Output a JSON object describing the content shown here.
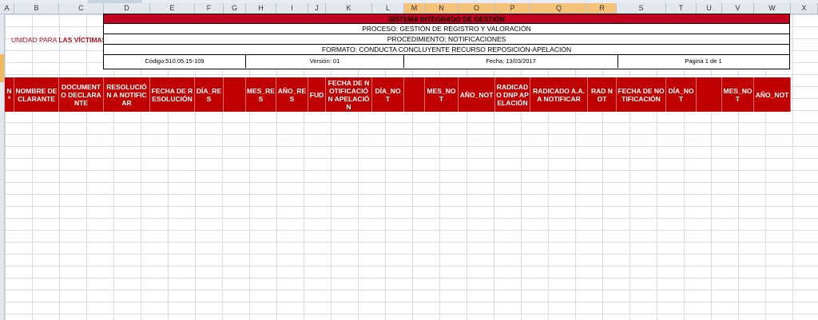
{
  "columns": [
    "A",
    "B",
    "C",
    "D",
    "E",
    "F",
    "G",
    "H",
    "I",
    "J",
    "K",
    "L",
    "M",
    "N",
    "O",
    "P",
    "Q",
    "R",
    "S",
    "T",
    "U",
    "V",
    "W",
    "X"
  ],
  "highlighted_columns": [
    "M",
    "N",
    "O",
    "P",
    "Q",
    "R"
  ],
  "logo": {
    "text_light": "UNIDAD PARA ",
    "text_bold": "LAS VÍCTIMAS"
  },
  "header": {
    "title": "SISTEMA INTEGRADO DE GESTIÓN",
    "process": "PROCESO: GESTIÓN DE REGISTRO Y VALORACIÓN",
    "procedure": "PROCEDIMIENTO: NOTIFICACIONES",
    "format": "FORMATO: CONDUCTA CONCLUYENTE RECURSO REPOSICIÓN-APELACIÓN",
    "code": "Código:510.05.15-109",
    "version": "Versión: 01",
    "date": "Fecha: 13/03/2017",
    "page": "Página 1 de 1"
  },
  "table_headers": [
    "Nº",
    "NOMBRE DECLARANTE",
    "DOCUMENTO DECLARANTE",
    "RESOLUCIÓN A NOTIFICAR",
    "FECHA DE RESOLUCIÓN",
    "DÍA_RES",
    "",
    "MES_RES",
    "AÑO_RES",
    "FUD",
    "FECHA DE NOTIFICACIÓN APELACIÓN",
    "DÍA_NOT",
    "",
    "MES_NOT",
    "AÑO_NOT",
    "RADICADO DNP APELACIÓN",
    "RADICADO A.A. A NOTIFICAR",
    "RAD NOT",
    "FECHA DE NOTIFICACIÓN",
    "DÍA_NOT",
    "",
    "MES_NOT",
    "AÑO_NOT"
  ],
  "colors": {
    "header_red": "#c00000",
    "title_red": "#c0001e"
  }
}
